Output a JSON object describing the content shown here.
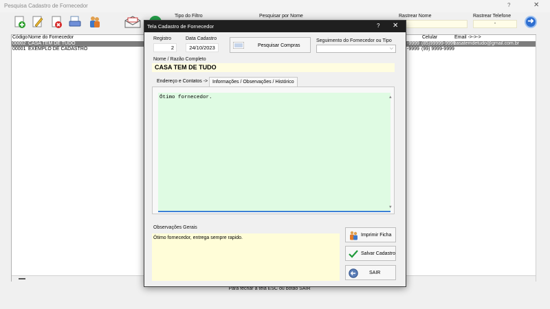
{
  "bg": {
    "title": "Pesquisa Cadastro de Fornecedor",
    "help": "?",
    "close": "✕",
    "filters": {
      "tipo_filtro": "Tipo do Filtro",
      "pesquisar_nome": "Pesquisar por Nome",
      "rastrear_nome": "Rastrear Nome",
      "rastrear_telefone": "Rastrear Telefone",
      "rastrear_telefone_value": "-"
    },
    "go_glyph": "➜",
    "grid": {
      "headers": [
        "Código",
        "Nome do Fornecedor",
        "Celular",
        "Email ->->->"
      ],
      "rows": [
        {
          "code": "00002",
          "name": "CASA TEM DE TUDO",
          "tel_frag": "-9999",
          "cel": "(85)99999-9999",
          "email": "casatemdetudo@gmail.com.br"
        },
        {
          "code": "00001",
          "name": "EXEMPLO DE CADASTRO",
          "tel_frag": "-9999",
          "cel": "(99) 9999-9999",
          "email": ""
        }
      ]
    },
    "footer_note": "Para fechar a tela ESC ou botão SAIR"
  },
  "modal": {
    "title": "Tela Cadastro de Fornecedor",
    "help": "?",
    "close": "✕",
    "registro_label": "Registro",
    "registro_value": "2",
    "data_label": "Data Cadastro",
    "data_value": "24/10/2023",
    "pesquisar_compras": "Pesquisar Compras",
    "segmento_label": "Seguimento do Fornecedor ou Tipo",
    "segmento_value": "",
    "nome_label": "Nome / Razão Completo",
    "nome_value": "CASA TEM DE TUDO",
    "tabs": [
      {
        "label": "Endereço e Contatos ->",
        "active": false
      },
      {
        "label": "Informações / Observações / Histórico",
        "active": true
      }
    ],
    "info_text": "Ótimo fornecedor.",
    "obs_label": "Observações Gerais",
    "obs_text": "Ótimo fornecedor, entrega sempre rapido.",
    "buttons": {
      "imprimir": "Imprimir Ficha",
      "salvar": "Salvar Cadastro",
      "sair": "SAIR"
    }
  },
  "colors": {
    "modal_titlebar": "#1f1f1f",
    "info_bg": "#dffbe3",
    "obs_bg": "#fffdd8",
    "name_bg": "#fffde0",
    "selected_row": "#7d7d7d"
  }
}
